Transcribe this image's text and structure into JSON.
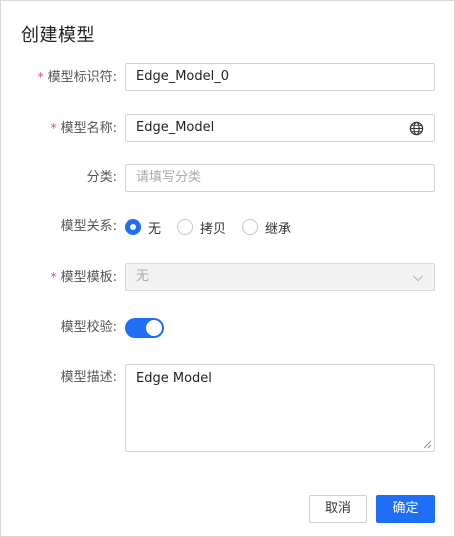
{
  "dialog": {
    "title": "创建模型"
  },
  "form": {
    "identifier": {
      "label": "模型标识符:",
      "value": "Edge_Model_0"
    },
    "name": {
      "label": "模型名称:",
      "value": "Edge_Model"
    },
    "category": {
      "label": "分类:",
      "placeholder": "请填写分类"
    },
    "relation": {
      "label": "模型关系:",
      "options": [
        "无",
        "拷贝",
        "继承"
      ],
      "selected": "无"
    },
    "template": {
      "label": "模型模板:",
      "value": "无"
    },
    "validation": {
      "label": "模型校验:",
      "enabled": true
    },
    "description": {
      "label": "模型描述:",
      "value": "Edge Model"
    }
  },
  "footer": {
    "cancel_label": "取消",
    "confirm_label": "确定"
  },
  "colors": {
    "primary": "#1e6ff5",
    "required": "#e34d59"
  }
}
